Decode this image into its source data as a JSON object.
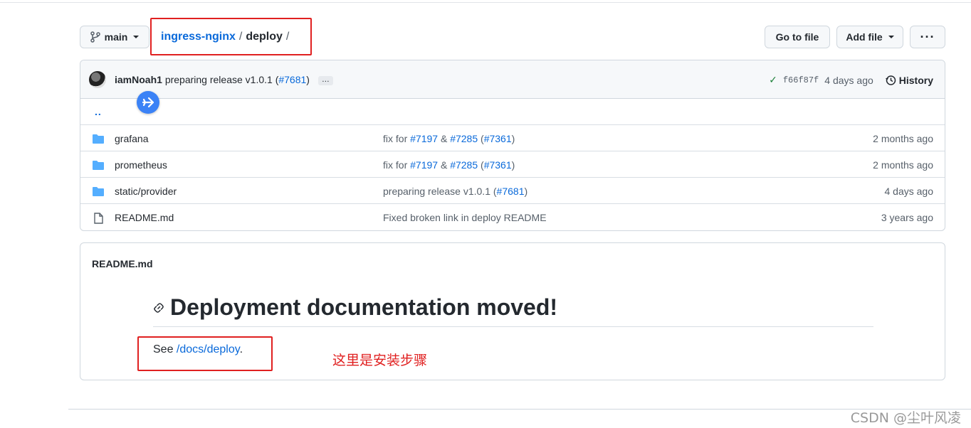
{
  "toolbar": {
    "branch": "main",
    "breadcrumb": {
      "repo": "ingress-nginx",
      "folder": "deploy",
      "sep": "/"
    },
    "go_to_file": "Go to file",
    "add_file": "Add file",
    "more": "···"
  },
  "commit": {
    "author": "iamNoah1",
    "message": "preparing release v1.0.1 (",
    "pr": "#7681",
    "message_end": ")",
    "ellipsis": "…",
    "sha": "f66f87f",
    "age": "4 days ago",
    "history": "History"
  },
  "parent_dir": "..",
  "files": [
    {
      "name": "grafana",
      "type": "folder",
      "msg_pre": "fix for ",
      "link1": "#7197",
      "amp": " & ",
      "link2": "#7285",
      "paren_open": " (",
      "link3": "#7361",
      "paren_close": ")",
      "age": "2 months ago"
    },
    {
      "name": "prometheus",
      "type": "folder",
      "msg_pre": "fix for ",
      "link1": "#7197",
      "amp": " & ",
      "link2": "#7285",
      "paren_open": " (",
      "link3": "#7361",
      "paren_close": ")",
      "age": "2 months ago"
    },
    {
      "name": "static/provider",
      "type": "folder",
      "msg_pre": "preparing release v1.0.1 (",
      "link1": "#7681",
      "paren_close": ")",
      "age": "4 days ago"
    },
    {
      "name": "README.md",
      "type": "file",
      "msg_pre": "Fixed broken link in deploy README",
      "age": "3 years ago"
    }
  ],
  "readme": {
    "title": "README.md",
    "heading": "Deployment documentation moved!",
    "see": "See ",
    "link": "/docs/deploy",
    "period": "."
  },
  "annotation": "这里是安装步骤",
  "watermark": "CSDN @尘叶风凌",
  "colors": {
    "link": "#0969da",
    "annotation_red": "#e02020",
    "folder": "#54aeff",
    "check": "#1a7f37"
  }
}
